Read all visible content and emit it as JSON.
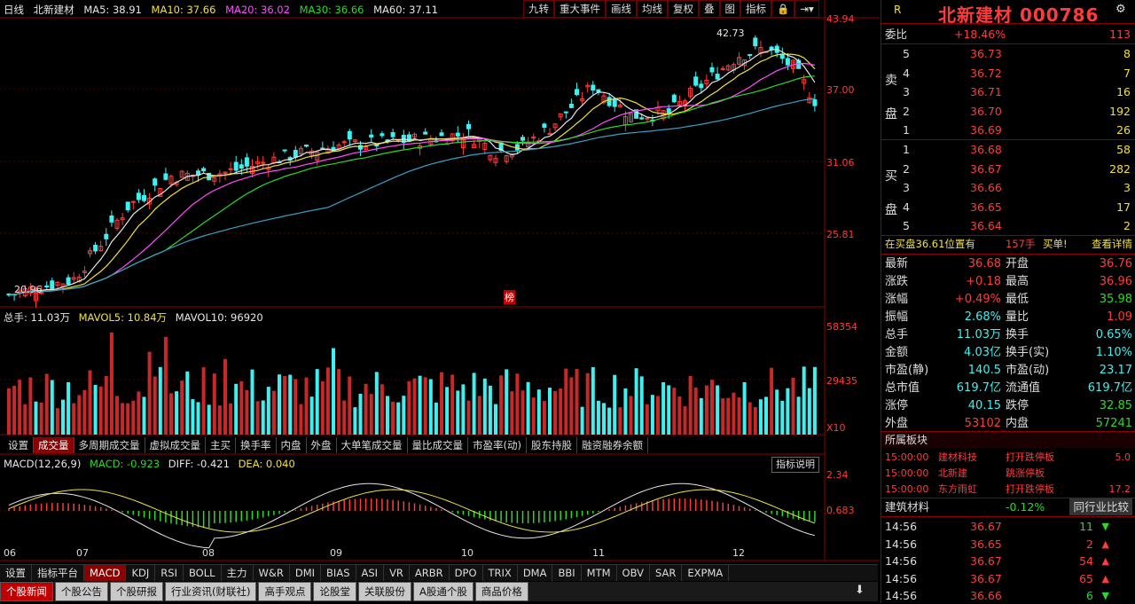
{
  "legend": {
    "period": "日线",
    "stock_name": "北新建材",
    "ma5": "MA5: 38.91",
    "ma10": "MA10: 37.66",
    "ma20": "MA20: 36.02",
    "ma30": "MA30: 36.66",
    "ma60": "MA60: 37.11"
  },
  "toolbar": [
    "九转",
    "重大事件",
    "画线",
    "均线",
    "复权",
    "叠",
    "图",
    "指标"
  ],
  "price_axis": [
    "43.94",
    "37.00",
    "31.06",
    "25.81"
  ],
  "price_labels": {
    "high": "42.73",
    "low": "20.96",
    "marker": "榜"
  },
  "vol_legend": {
    "total": "总手: 11.03万",
    "mavol5": "MAVOL5: 10.84万",
    "mavol10": "MAVOL10: 96920"
  },
  "vol_axis": [
    "58354",
    "29435",
    "X10"
  ],
  "indicator_tabs": [
    "设置",
    "成交量",
    "多周期成交量",
    "虚拟成交量",
    "主买",
    "换手率",
    "内盘",
    "外盘",
    "大单笔成交量",
    "量比成交量",
    "市盈率(动)",
    "股东持股",
    "融资融券余额"
  ],
  "macd_legend": {
    "name": "MACD(12,26,9)",
    "macd": "MACD: -0.923",
    "diff": "DIFF: -0.421",
    "dea": "DEA: 0.040"
  },
  "macd_axis": [
    "2.34",
    "0.683"
  ],
  "macd_button": "指标说明",
  "date_axis": [
    "06",
    "07",
    "08",
    "09",
    "10",
    "11",
    "12"
  ],
  "bottom_tabs": [
    "设置",
    "指标平台",
    "MACD",
    "KDJ",
    "RSI",
    "BOLL",
    "主力",
    "W&R",
    "DMI",
    "BIAS",
    "ASI",
    "VR",
    "ARBR",
    "DPO",
    "TRIX",
    "DMA",
    "BBI",
    "MTM",
    "OBV",
    "SAR",
    "EXPMA"
  ],
  "news_tabs": [
    "个股新闻",
    "个股公告",
    "个股研报",
    "行业资讯(财联社)",
    "高手观点",
    "论股堂",
    "关联股份",
    "A股通个股",
    "商品价格"
  ],
  "quote": {
    "title": "北新建材 000786",
    "r_label": "R",
    "weibi_label": "委比",
    "weibi": "+18.46%",
    "weicha": "113",
    "sell_label": "卖盘",
    "buy_label": "买盘",
    "asks": [
      {
        "lv": "5",
        "price": "36.73",
        "vol": "8"
      },
      {
        "lv": "4",
        "price": "36.72",
        "vol": "7"
      },
      {
        "lv": "3",
        "price": "36.71",
        "vol": "16"
      },
      {
        "lv": "2",
        "price": "36.70",
        "vol": "192"
      },
      {
        "lv": "1",
        "price": "36.69",
        "vol": "26"
      }
    ],
    "bids": [
      {
        "lv": "1",
        "price": "36.68",
        "vol": "58"
      },
      {
        "lv": "2",
        "price": "36.67",
        "vol": "282"
      },
      {
        "lv": "3",
        "price": "36.66",
        "vol": "3"
      },
      {
        "lv": "4",
        "price": "36.65",
        "vol": "17"
      },
      {
        "lv": "5",
        "price": "36.64",
        "vol": "2"
      }
    ],
    "inner_bar": {
      "left": "在买盘36.61位置有",
      "mid": "157手",
      "buy": "买单!",
      "right": "查看详情"
    },
    "stats": [
      [
        "最新",
        "36.68",
        "开盘",
        "36.76"
      ],
      [
        "涨跌",
        "+0.18",
        "最高",
        "36.96"
      ],
      [
        "涨幅",
        "+0.49%",
        "最低",
        "35.98"
      ],
      [
        "振幅",
        "2.68%",
        "量比",
        "1.09"
      ],
      [
        "总手",
        "11.03万",
        "换手",
        "0.65%"
      ],
      [
        "金额",
        "4.03亿",
        "换手(实)",
        "1.10%"
      ],
      [
        "市盈(静)",
        "140.5",
        "市盈(动)",
        "23.17"
      ],
      [
        "总市值",
        "619.7亿",
        "流通值",
        "619.7亿"
      ],
      [
        "涨停",
        "40.15",
        "跌停",
        "32.85"
      ],
      [
        "外盘",
        "53102",
        "内盘",
        "57241"
      ]
    ],
    "related_title": "所属板块",
    "related": [
      [
        "15:00:00",
        "建材科技",
        "打开跌停板",
        "5.0"
      ],
      [
        "15:00:00",
        "北新建",
        "跳涨停板",
        ""
      ],
      [
        "15:00:00",
        "东方雨虹",
        "打开跌停板",
        "17.2"
      ]
    ],
    "sector": {
      "name": "建筑材料",
      "pct": "-0.12%",
      "link": "同行业比较"
    },
    "ticks": [
      {
        "t": "14:56",
        "p": "36.67",
        "v": "11",
        "dir": "down"
      },
      {
        "t": "14:56",
        "p": "36.65",
        "v": "2",
        "dir": "up"
      },
      {
        "t": "14:56",
        "p": "36.67",
        "v": "54",
        "dir": "up"
      },
      {
        "t": "14:56",
        "p": "36.67",
        "v": "65",
        "dir": "up"
      },
      {
        "t": "14:56",
        "p": "36.66",
        "v": "6",
        "dir": "down"
      }
    ]
  },
  "colors": {
    "up": "#ff3b3b",
    "down": "#3ef0ef",
    "ma5": "#e6e6e6",
    "ma10": "#f0e040",
    "ma20": "#ff4dff",
    "ma30": "#2bd92b",
    "ma60": "#3aa0c8",
    "border": "#8b0000"
  }
}
